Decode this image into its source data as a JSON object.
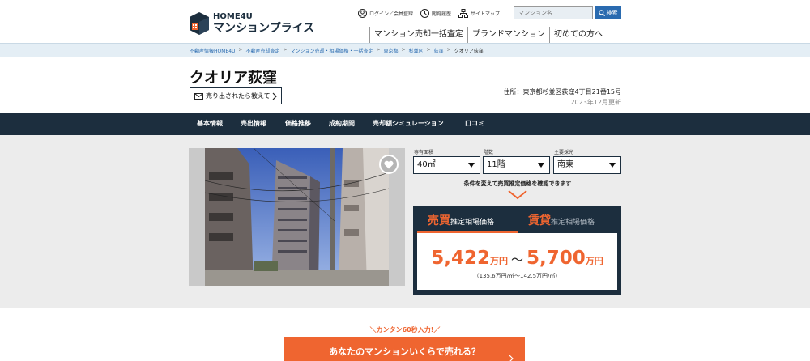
{
  "logo": {
    "top": "HOME4U",
    "bottom": "マンションプライス"
  },
  "header_links": {
    "login": "ログイン／会員登録",
    "history": "閲覧履歴",
    "sitemap": "サイトマップ"
  },
  "search": {
    "placeholder": "マンション名",
    "button": "検索"
  },
  "nav": [
    "マンション売却一括査定",
    "ブランドマンション",
    "初めての方へ"
  ],
  "breadcrumb": [
    "不動産情報HOME4U",
    "不動産売却査定",
    "マンション売却・相場価格・一括査定",
    "東京都",
    "杉並区",
    "荻窪",
    "クオリア荻窪"
  ],
  "property": {
    "title": "クオリア荻窪",
    "notify_button": "売り出されたら教えて",
    "address": "住所：東京都杉並区荻窪4丁目21番15号",
    "updated": "2023年12月更新"
  },
  "tabs": [
    "基本情報",
    "売出情報",
    "価格推移",
    "成約期間",
    "売却額シミュレーション",
    "口コミ"
  ],
  "filters": {
    "area": {
      "label": "専有面積",
      "value": "40㎡"
    },
    "floor": {
      "label": "階数",
      "value": "11階"
    },
    "direction": {
      "label": "主要採光",
      "value": "南東"
    }
  },
  "hint": "条件を変えて売買推定価格を確認できます",
  "price": {
    "sale_tab_strong": "売買",
    "sale_tab_rest": "推定相場価格",
    "rent_tab_strong": "賃貸",
    "rent_tab_rest": "推定相場価格",
    "low": "5,422",
    "high": "5,700",
    "unit": "万円",
    "tilde": "～",
    "per_sqm": "（135.6万円/㎡～142.5万円/㎡）"
  },
  "promo": {
    "tagline": "＼カンタン60秒入力!／",
    "cta": "あなたのマンションいくらで売れる？"
  },
  "colors": {
    "navy": "#1c2e3e",
    "accent": "#ef6530",
    "link": "#2a6bb0"
  }
}
